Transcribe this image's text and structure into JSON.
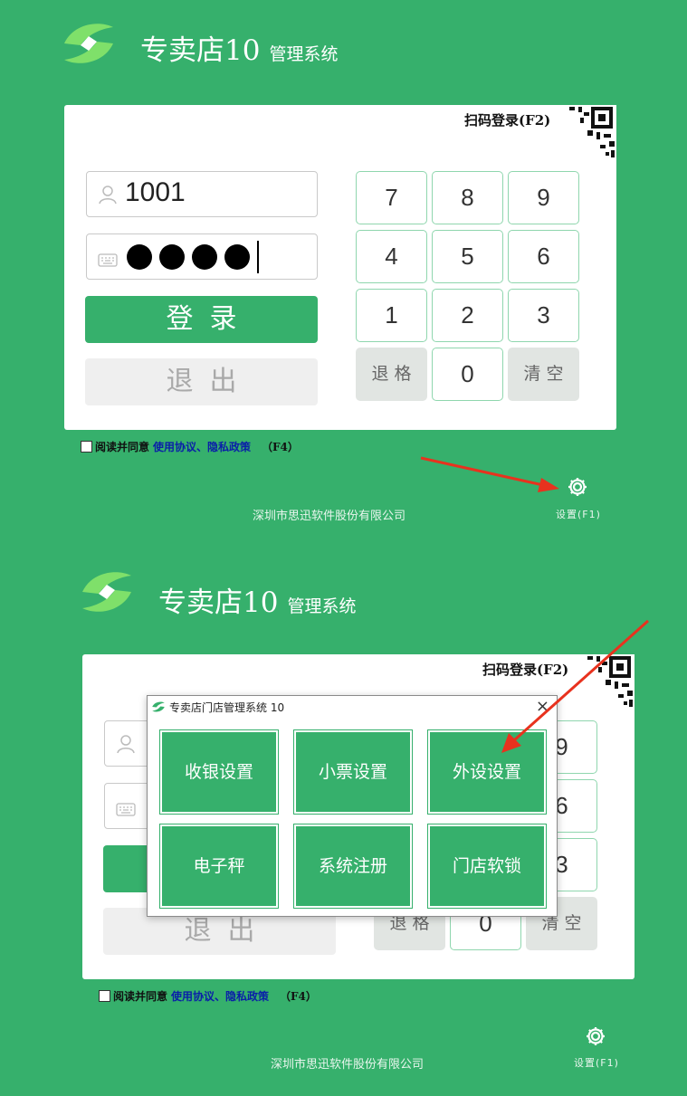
{
  "brand": {
    "name": "专卖店10",
    "subtitle": "管理系统"
  },
  "login": {
    "qr_login": "扫码登录(F2)",
    "username_value": "1001",
    "password_dots": 4,
    "login_label": "登录",
    "exit_label": "退出"
  },
  "keypad": {
    "keys": [
      "7",
      "8",
      "9",
      "4",
      "5",
      "6",
      "1",
      "2",
      "3",
      "退格",
      "0",
      "清空"
    ]
  },
  "agreement": {
    "read_agree": "阅读并同意",
    "terms": "使用协议、隐私政策",
    "shortcut": "（F4）"
  },
  "footer": {
    "company": "深圳市思迅软件股份有限公司",
    "settings": "设置(F1)"
  },
  "dialog": {
    "title": "专卖店门店管理系统 10",
    "close": "×",
    "tiles": [
      "收银设置",
      "小票设置",
      "外设设置",
      "电子秤",
      "系统注册",
      "门店软锁"
    ]
  },
  "colors": {
    "brand_green": "#36b06c",
    "arrow_red": "#e8321e",
    "link_blue": "#0a1fa8"
  },
  "icons": {
    "logo": "leaf-logo-icon",
    "user": "user-icon",
    "keyboard": "keyboard-icon",
    "qr": "qr-code-icon",
    "gear": "gear-icon",
    "close": "close-icon"
  }
}
